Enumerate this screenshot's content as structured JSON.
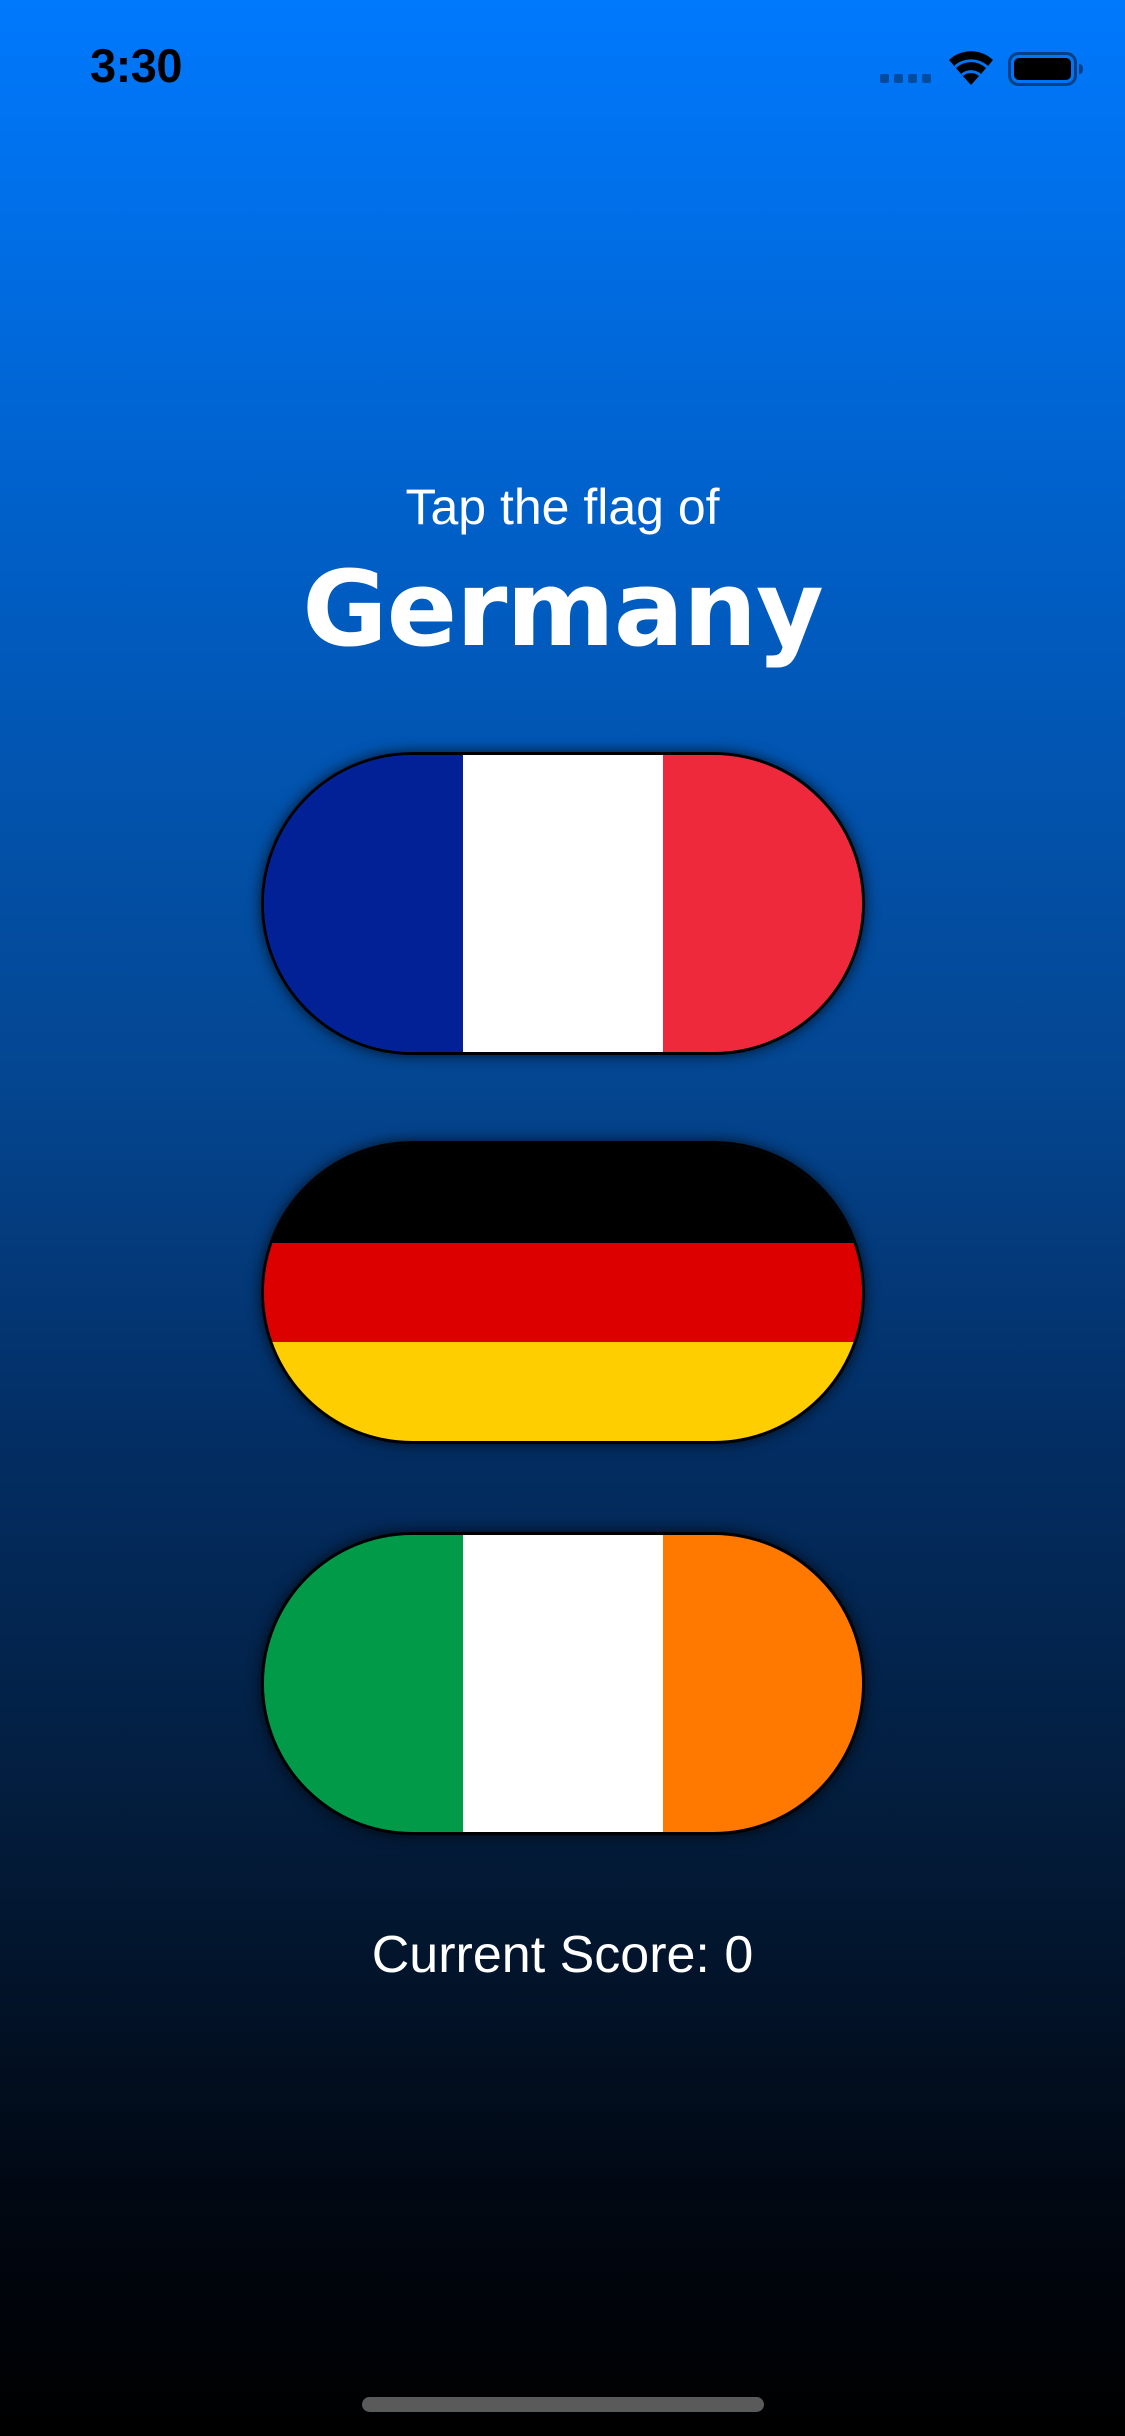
{
  "status_bar": {
    "time": "3:30",
    "icons": [
      "cellular-signal-icon",
      "wifi-icon",
      "battery-icon"
    ]
  },
  "prompt": {
    "instruction": "Tap the flag of",
    "country": "Germany"
  },
  "flags": [
    {
      "country_name": "France",
      "orientation": "vertical",
      "colors": [
        "#022196",
        "#ffffff",
        "#ed293b"
      ]
    },
    {
      "country_name": "Germany",
      "orientation": "horizontal",
      "colors": [
        "#000000",
        "#dd0000",
        "#ffce00"
      ]
    },
    {
      "country_name": "Ireland",
      "orientation": "vertical",
      "colors": [
        "#009a49",
        "#ffffff",
        "#ff7900"
      ]
    }
  ],
  "score": {
    "text": "Current Score: 0"
  },
  "colors": {
    "background_top": "#0079fd",
    "background_bottom": "#000000",
    "text": "#ffffff"
  }
}
